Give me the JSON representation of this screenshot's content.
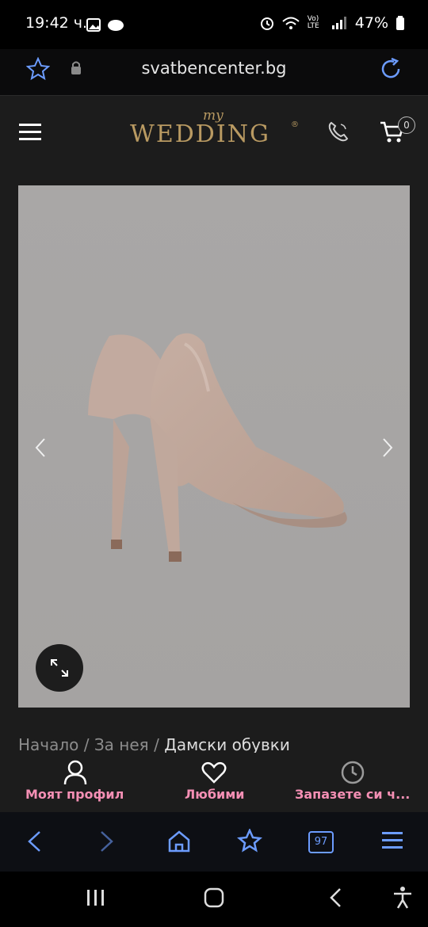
{
  "status": {
    "time": "19:42 ч.",
    "battery": "47%",
    "signal_text": "Vo) LTE"
  },
  "browser": {
    "url": "svatbencenter.bg",
    "tabs_count": "97"
  },
  "header": {
    "logo_small": "my",
    "logo_main": "WEDDING",
    "logo_reg": "®",
    "cart_count": "0"
  },
  "breadcrumb": {
    "items": [
      "Начало",
      "За нея",
      "Дамски обувки"
    ],
    "separator": "/"
  },
  "site_nav": {
    "profile": "Моят профил",
    "favorites": "Любими",
    "booking": "Запазете си ч..."
  },
  "colors": {
    "accent_pink": "#f48fb4",
    "logo_gold": "#b99a62",
    "browser_blue": "#6c9cff"
  }
}
